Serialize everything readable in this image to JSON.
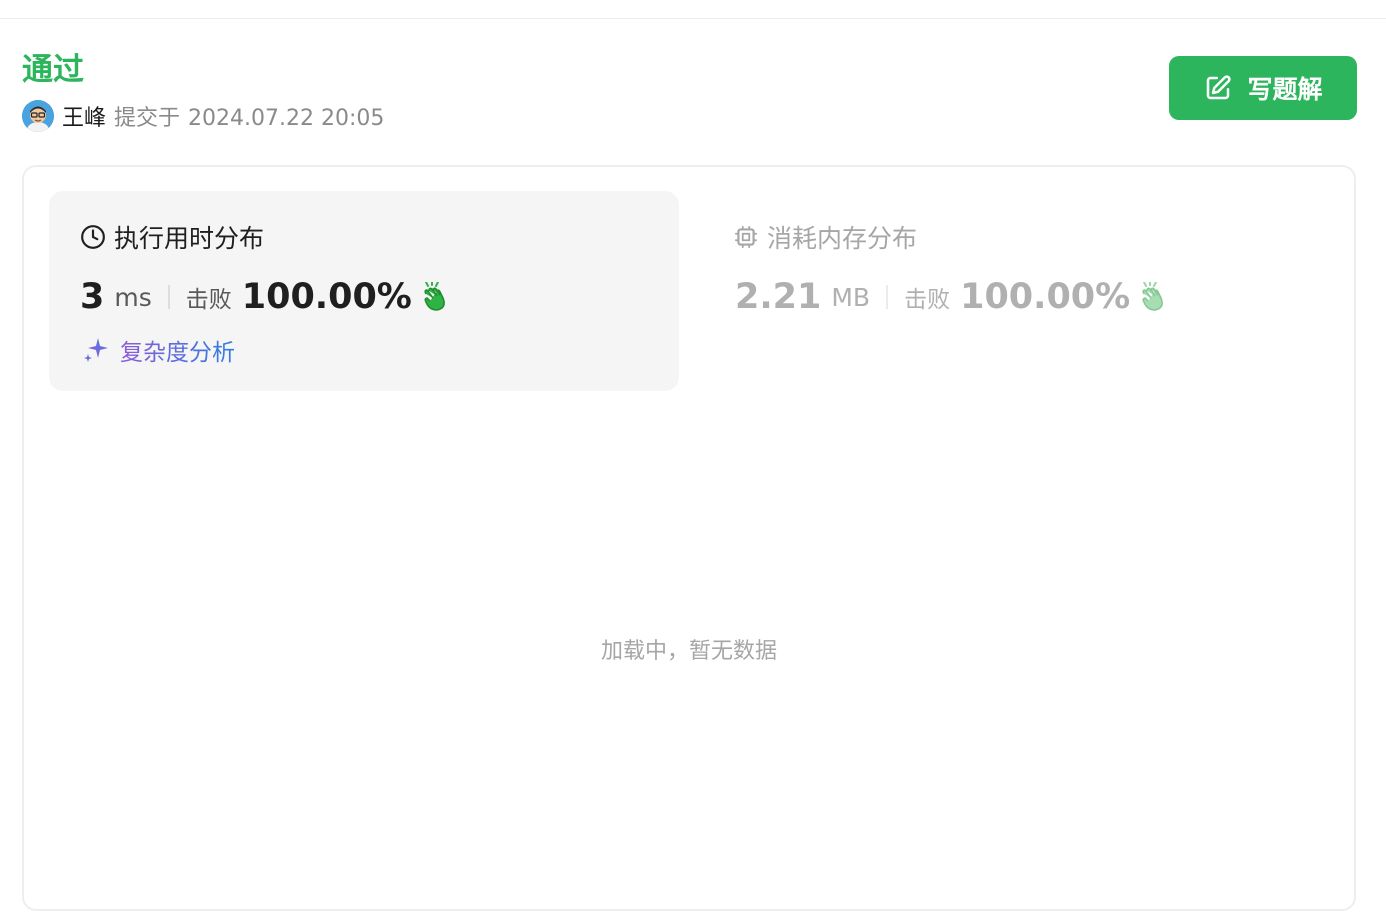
{
  "header": {
    "status": "通过",
    "username": "王峰",
    "submitted_label": "提交于",
    "submitted_at": "2024.07.22 20:05",
    "write_solution_label": "写题解"
  },
  "runtime": {
    "title": "执行用时分布",
    "value": "3",
    "unit": "ms",
    "beats_label": "击败",
    "beats_percent": "100.00%",
    "analysis_label": "复杂度分析"
  },
  "memory": {
    "title": "消耗内存分布",
    "value": "2.21",
    "unit": "MB",
    "beats_label": "击败",
    "beats_percent": "100.00%"
  },
  "chart_area": {
    "loading_text": "加载中，暂无数据"
  },
  "icons": {
    "avatar": "avatar-image",
    "write": "edit-icon",
    "runtime": "clock-icon",
    "memory": "chip-icon",
    "clap": "clap-icon",
    "analysis": "sparkle-icon"
  },
  "colors": {
    "accent_green": "#2db55d",
    "clap_green": "#2fb344",
    "muted_gray": "#a6a6a6"
  }
}
